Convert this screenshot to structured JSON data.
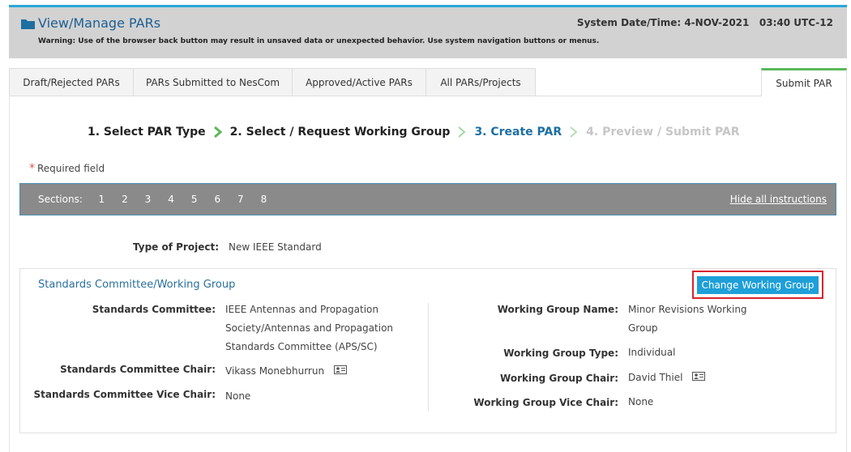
{
  "header": {
    "title": "View/Manage PARs",
    "warning": "Warning: Use of the browser back button may result in unsaved data or unexpected behavior. Use system navigation buttons or menus.",
    "system_datetime_label": "System Date/Time: 4-NOV-2021",
    "system_time": "03:40 UTC-12"
  },
  "tabs": [
    {
      "label": "Draft/Rejected PARs"
    },
    {
      "label": "PARs Submitted to NesCom"
    },
    {
      "label": "Approved/Active PARs"
    },
    {
      "label": "All PARs/Projects"
    },
    {
      "label": "Submit PAR"
    }
  ],
  "steps": [
    {
      "label": "1. Select PAR Type"
    },
    {
      "label": "2. Select / Request Working Group"
    },
    {
      "label": "3. Create PAR"
    },
    {
      "label": "4. Preview / Submit PAR"
    }
  ],
  "required_text": "Required field",
  "sections_bar": {
    "label": "Sections:",
    "numbers": [
      "1",
      "2",
      "3",
      "4",
      "5",
      "6",
      "7",
      "8"
    ],
    "hide_link": "Hide all instructions"
  },
  "project": {
    "type_label": "Type of Project:",
    "type_value": "New IEEE Standard"
  },
  "working_group_box": {
    "title": "Standards Committee/Working Group",
    "change_button": "Change Working Group",
    "left": {
      "committee_label": "Standards Committee:",
      "committee_value": "IEEE Antennas and Propagation Society/Antennas and Propagation Standards Committee (APS/SC)",
      "chair_label": "Standards Committee Chair:",
      "chair_value": "Vikass Monebhurrun",
      "vice_chair_label": "Standards Committee Vice Chair:",
      "vice_chair_value": "None"
    },
    "right": {
      "wg_name_label": "Working Group Name:",
      "wg_name_value": "Minor Revisions Working Group",
      "wg_type_label": "Working Group Type:",
      "wg_type_value": "Individual",
      "wg_chair_label": "Working Group Chair:",
      "wg_chair_value": "David Thiel",
      "wg_vice_chair_label": "Working Group Vice Chair:",
      "wg_vice_chair_value": "None"
    }
  },
  "colors": {
    "accent_blue": "#1e9fd8",
    "title_blue": "#1d5f93",
    "highlight_red": "#d9232e",
    "step_green": "#5cb85c"
  }
}
